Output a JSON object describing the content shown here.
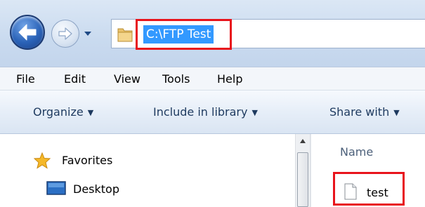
{
  "navigation": {
    "back_icon": "back-arrow-icon",
    "forward_icon": "forward-arrow-icon",
    "history_icon": "chevron-down-icon"
  },
  "address_bar": {
    "folder_icon": "folder-icon",
    "value": "C:\\FTP Test",
    "selected": true
  },
  "menu": {
    "items": [
      {
        "label": "File"
      },
      {
        "label": "Edit"
      },
      {
        "label": "View"
      },
      {
        "label": "Tools"
      },
      {
        "label": "Help"
      }
    ]
  },
  "command_bar": {
    "items": [
      {
        "label": "Organize"
      },
      {
        "label": "Include in library"
      },
      {
        "label": "Share with"
      }
    ]
  },
  "nav_pane": {
    "items": [
      {
        "label": "Favorites",
        "icon": "star-icon"
      },
      {
        "label": "Desktop",
        "icon": "desktop-icon"
      }
    ]
  },
  "content": {
    "column_header": "Name",
    "files": [
      {
        "name": "test",
        "icon": "text-file-icon"
      }
    ]
  },
  "colors": {
    "selection": "#3399ff",
    "highlight_box": "#e8141c"
  }
}
